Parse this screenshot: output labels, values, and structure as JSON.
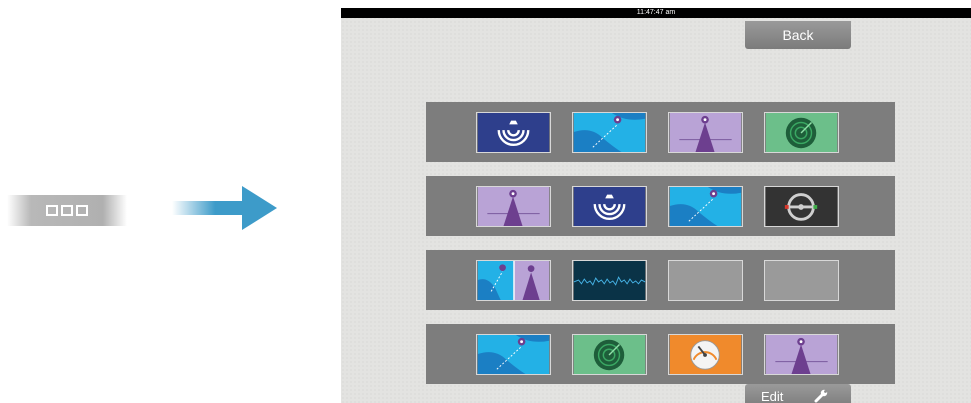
{
  "status_bar": {
    "time": "11:47:47 am"
  },
  "back_button": {
    "label": "Back"
  },
  "edit_button": {
    "label": "Edit",
    "icon": "wrench-icon"
  },
  "home_button": {
    "icon": "pages-icon"
  },
  "rows": [
    {
      "tiles": [
        "sonar",
        "chart",
        "radar-overlay",
        "radar"
      ]
    },
    {
      "tiles": [
        "radar-overlay",
        "sonar",
        "chart",
        "autopilot"
      ]
    },
    {
      "tiles": [
        "chart-radar-split",
        "sonar-waveform",
        "empty",
        "empty"
      ]
    },
    {
      "tiles": [
        "chart",
        "radar",
        "gauge",
        "radar-overlay"
      ]
    }
  ],
  "colors": {
    "sonar_bg": "#2e3f8c",
    "chart_water": "#23b1e6",
    "radar_overlay_bg": "#b9a3d6",
    "radar_bg": "#6cbf8a",
    "autopilot_bg": "#333333",
    "gauge_bg": "#f08a2c",
    "waveform_bg": "#0a3347",
    "empty_bg": "#9a9a9a"
  }
}
